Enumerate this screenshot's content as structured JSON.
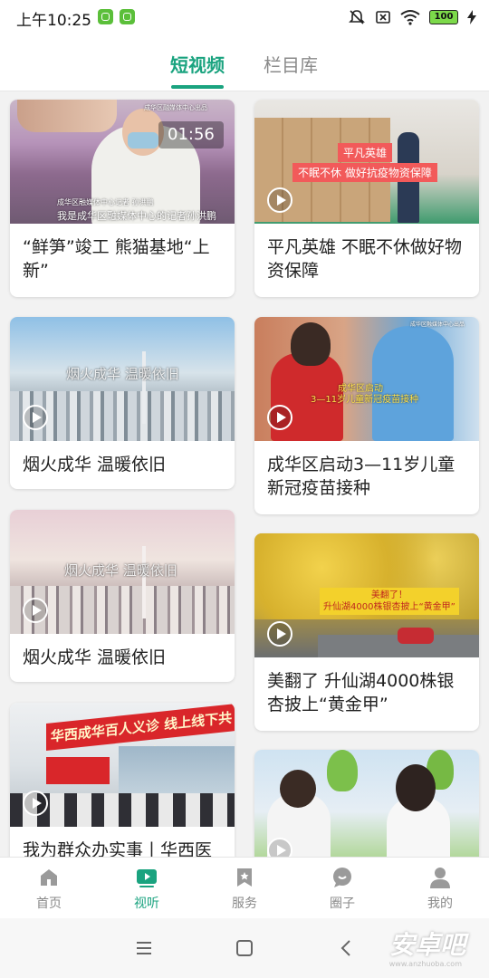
{
  "status_bar": {
    "time": "上午10:25",
    "battery": "100",
    "icons": [
      "app-notification-icon",
      "app-notification-icon",
      "mute-icon",
      "sim-off-icon",
      "wifi-icon",
      "battery-icon",
      "charging-icon"
    ]
  },
  "tabs": [
    {
      "label": "短视频",
      "active": true
    },
    {
      "label": "栏目库",
      "active": false
    }
  ],
  "accent_color": "#1aa37f",
  "feed": [
    {
      "title": "“鲜笋”竣工 熊猫基地“上新”",
      "duration": "01:56",
      "captions": [
        "我是成华区融媒体中心的记者孙洪鹏",
        "成华区融媒体中心记者 孙洪鹏",
        "成华区融媒体中心出品"
      ]
    },
    {
      "title": "平凡英雄 不眠不休做好物资保障",
      "captions": [
        "平凡英雄",
        "不眠不休 做好抗疫物资保障"
      ]
    },
    {
      "title": "烟火成华 温暖依旧",
      "captions": [
        "烟火成华 温暖依旧"
      ]
    },
    {
      "title": "成华区启动3—11岁儿童新冠疫苗接种",
      "captions": [
        "成华区启动",
        "3—11岁儿童新冠疫苗接种",
        "成华区融媒体中心出品"
      ]
    },
    {
      "title": "烟火成华 温暖依旧",
      "captions": [
        "烟火成华 温暖依旧"
      ]
    },
    {
      "title": "美翻了 升仙湖4000株银杏披上“黄金甲”",
      "captions": [
        "美翻了！",
        "升仙湖4000株银杏披上“黄金甲”"
      ]
    },
    {
      "title": "我为群众办实事丨华西医",
      "captions": [
        "华西成华百人义诊 线上线下共办实事"
      ]
    },
    {
      "title": "",
      "captions": []
    }
  ],
  "bottom_nav": [
    {
      "label": "首页",
      "icon": "home-icon",
      "active": false
    },
    {
      "label": "视听",
      "icon": "video-play-icon",
      "active": true
    },
    {
      "label": "服务",
      "icon": "bookmark-icon",
      "active": false
    },
    {
      "label": "圈子",
      "icon": "chat-bubble-icon",
      "active": false
    },
    {
      "label": "我的",
      "icon": "person-icon",
      "active": false
    }
  ],
  "system_nav": {
    "buttons": [
      "menu-icon",
      "home-square-icon",
      "back-icon"
    ]
  },
  "watermark": {
    "text": "安卓吧",
    "sub": "www.anzhuoba.com"
  }
}
